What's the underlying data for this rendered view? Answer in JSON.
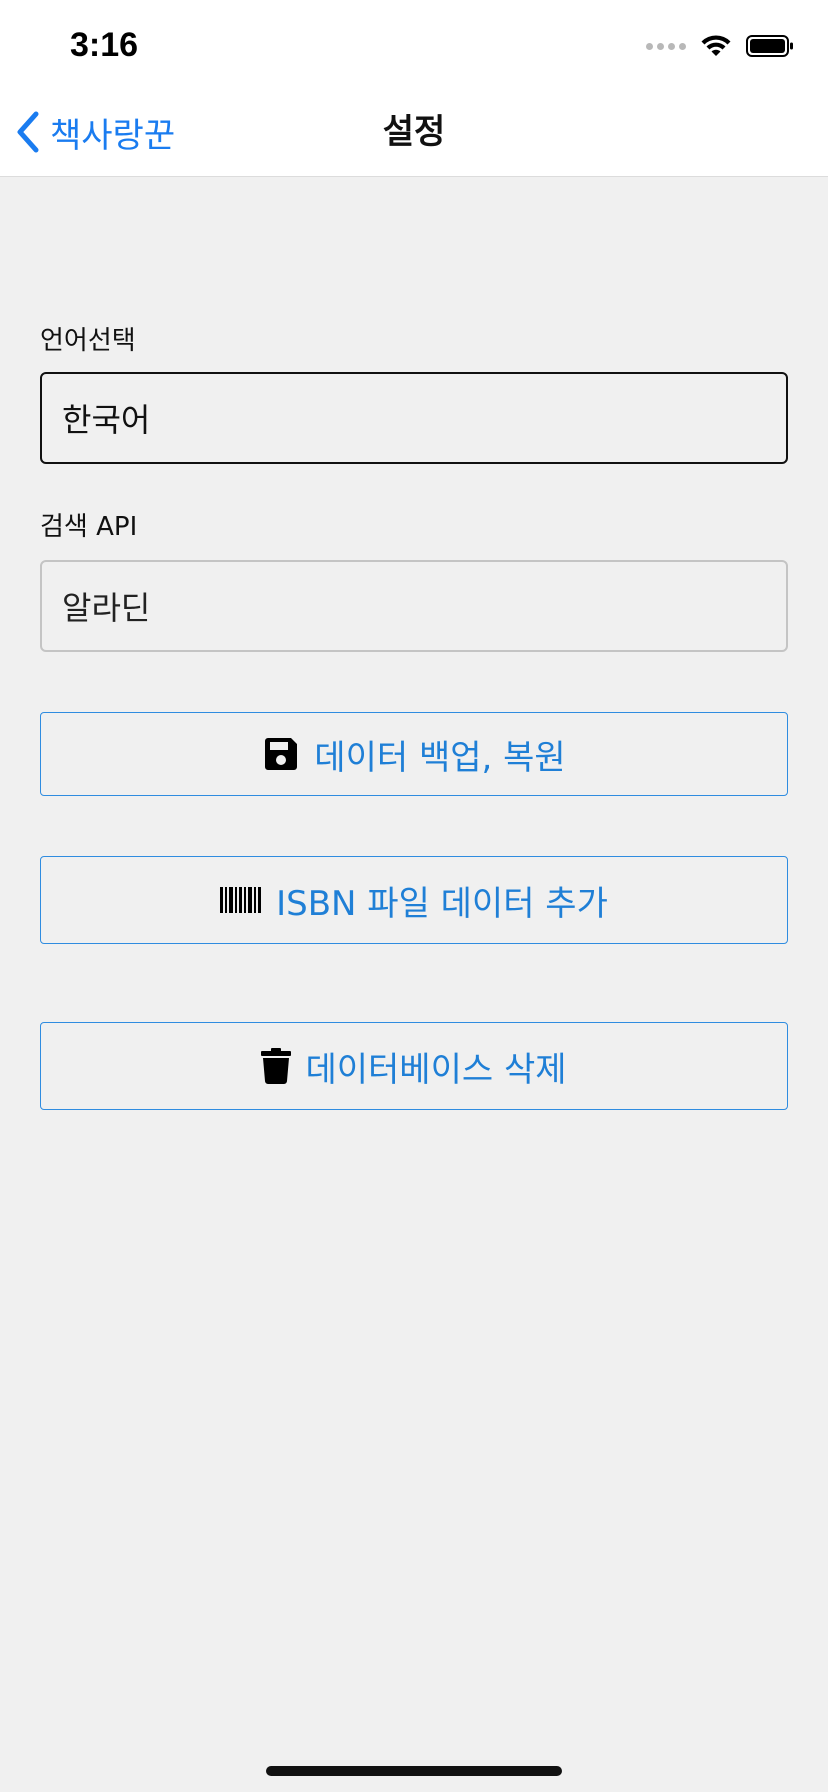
{
  "status_bar": {
    "time": "3:16"
  },
  "nav": {
    "back_label": "책사랑꾼",
    "title": "설정"
  },
  "language": {
    "label": "언어선택",
    "value": "한국어"
  },
  "search_api": {
    "label": "검색 API",
    "value": "알라딘"
  },
  "actions": {
    "backup_label": "데이터 백업, 복원",
    "isbn_label": "ISBN 파일 데이터 추가",
    "delete_label": "데이터베이스 삭제"
  },
  "colors": {
    "accent": "#1a7cf0",
    "button_text": "#1f7fd6",
    "background": "#f0f0f0"
  },
  "icons": {
    "backup": "floppy-disk-icon",
    "isbn": "barcode-icon",
    "delete": "trash-icon"
  }
}
